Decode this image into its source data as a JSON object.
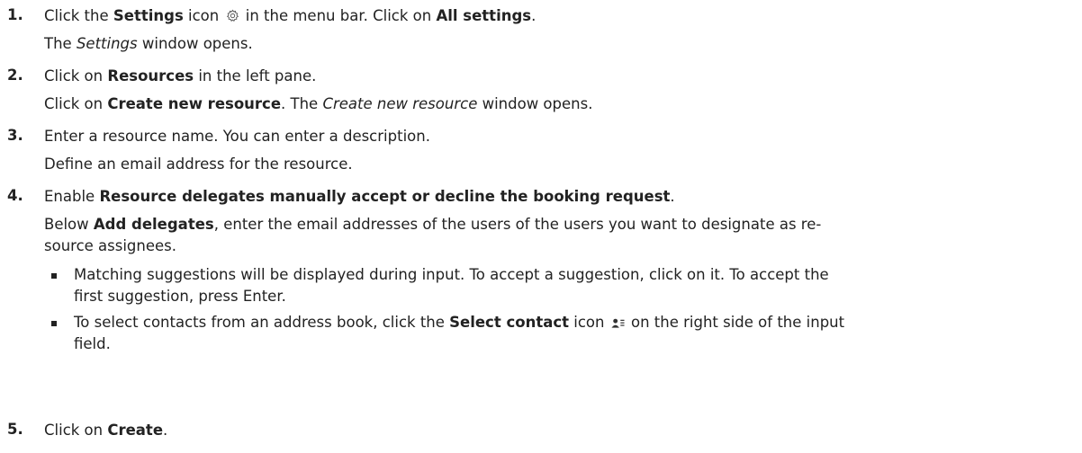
{
  "steps": [
    {
      "number": "1.",
      "line1": {
        "a": "Click the ",
        "b": "Settings",
        "c": " icon",
        "d": " in the menu bar. Click on ",
        "e": "All settings",
        "f": "."
      },
      "line2": {
        "a": "The ",
        "b": "Settings",
        "c": " window opens."
      },
      "icon": "settings-gear-icon"
    },
    {
      "number": "2.",
      "line1": {
        "a": "Click on ",
        "b": "Resources",
        "c": " in the left pane."
      },
      "line2": {
        "a": "Click on ",
        "b": "Create new resource",
        "c": ". The ",
        "d": "Create new resource",
        "e": " window opens."
      }
    },
    {
      "number": "3.",
      "line1": "Enter a resource name. You can enter a description.",
      "line2": "Define an email address for the resource."
    },
    {
      "number": "4.",
      "line1": {
        "a": "Enable ",
        "b": "Resource delegates manually accept or decline the booking request",
        "c": "."
      },
      "line2": {
        "a": "Below ",
        "b": "Add delegates",
        "c": ", enter the email addresses of the users of the users you want to designate as re-",
        "d": "source assignees."
      },
      "bullets": [
        {
          "a": "Matching suggestions will be displayed during input. To accept a suggestion, click on it. To accept the",
          "b": "first suggestion, press Enter."
        },
        {
          "a": "To select contacts from an address book, click the ",
          "b": "Select contact",
          "c": " icon",
          "d": " on the right side of the input",
          "e": "field.",
          "icon": "select-contact-icon"
        }
      ]
    },
    {
      "number": "5.",
      "line1": {
        "a": "Click on ",
        "b": "Create",
        "c": "."
      }
    }
  ]
}
